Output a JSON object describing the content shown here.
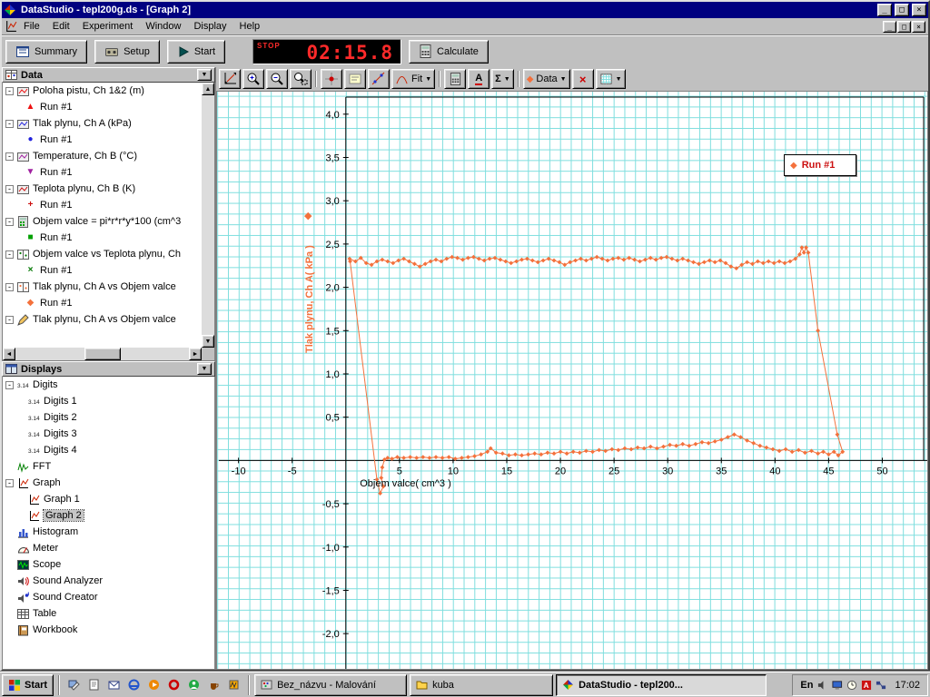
{
  "window": {
    "title": "DataStudio - tepl200g.ds - [Graph 2]"
  },
  "menu": {
    "items": [
      "File",
      "Edit",
      "Experiment",
      "Window",
      "Display",
      "Help"
    ]
  },
  "toolbar": {
    "summary_label": "Summary",
    "setup_label": "Setup",
    "start_label": "Start",
    "timer_stop": "STOP",
    "timer_value": "02:15.8",
    "calculate_label": "Calculate"
  },
  "graph_toolbar": {
    "fit_label": "Fit",
    "text_label": "A",
    "sigma_label": "Σ",
    "data_label": "Data"
  },
  "data_panel": {
    "title": "Data",
    "items": [
      {
        "label": "Poloha pistu, Ch 1&2 (m)",
        "icon": "measurement-icon",
        "marker": "triangle-up",
        "marker_color": "#ee1111",
        "run": "Run #1"
      },
      {
        "label": "Tlak plynu, Ch A (kPa)",
        "icon": "measurement-icon",
        "marker": "circle",
        "marker_color": "#2222dd",
        "run": "Run #1"
      },
      {
        "label": "Temperature, Ch B (°C)",
        "icon": "measurement-icon",
        "marker": "triangle-down",
        "marker_color": "#a020a0",
        "run": "Run #1"
      },
      {
        "label": "Teplota plynu, Ch B (K)",
        "icon": "measurement-icon",
        "marker": "plus",
        "marker_color": "#cc1111",
        "run": "Run #1"
      },
      {
        "label": "Objem valce = pi*r*r*y*100 (cm^3",
        "icon": "calculator-icon",
        "marker": "square",
        "marker_color": "#00a000",
        "run": "Run #1"
      },
      {
        "label": "Objem valce vs Teplota plynu, Ch",
        "icon": "xy-data-icon",
        "marker": "x",
        "marker_color": "#007700",
        "run": "Run #1"
      },
      {
        "label": "Tlak plynu, Ch A vs Objem valce",
        "icon": "xy-data-icon",
        "marker": "diamond",
        "marker_color": "#f4713c",
        "run": "Run #1"
      },
      {
        "label": "Tlak plynu, Ch A vs Objem valce",
        "icon": "pencil-icon",
        "marker": null,
        "marker_color": "#404040",
        "run": null
      }
    ]
  },
  "displays_panel": {
    "title": "Displays",
    "items": [
      {
        "label": "Digits",
        "icon": "digits-icon",
        "children": [
          {
            "label": "Digits 1",
            "icon": "digits-icon"
          },
          {
            "label": "Digits 2",
            "icon": "digits-icon"
          },
          {
            "label": "Digits 3",
            "icon": "digits-icon"
          },
          {
            "label": "Digits 4",
            "icon": "digits-icon"
          }
        ]
      },
      {
        "label": "FFT",
        "icon": "fft-icon"
      },
      {
        "label": "Graph",
        "icon": "graph-icon",
        "children": [
          {
            "label": "Graph 1",
            "icon": "graph-icon"
          },
          {
            "label": "Graph 2",
            "icon": "graph-icon",
            "selected": true
          }
        ]
      },
      {
        "label": "Histogram",
        "icon": "histogram-icon"
      },
      {
        "label": "Meter",
        "icon": "meter-icon"
      },
      {
        "label": "Scope",
        "icon": "scope-icon"
      },
      {
        "label": "Sound Analyzer",
        "icon": "sound-analyzer-icon"
      },
      {
        "label": "Sound Creator",
        "icon": "sound-creator-icon"
      },
      {
        "label": "Table",
        "icon": "table-icon"
      },
      {
        "label": "Workbook",
        "icon": "workbook-icon"
      }
    ]
  },
  "chart_data": {
    "type": "scatter",
    "title": "",
    "xlabel": "Objem valce( cm^3 )",
    "ylabel": "Tlak plynu, Ch A( kPa )",
    "xlim": [
      -12,
      54.7
    ],
    "ylim": [
      -2.47,
      4.26
    ],
    "grid": true,
    "grid_color": "#7edede",
    "legend_position": "top-right",
    "legend": {
      "label": "Run #1",
      "marker": "diamond",
      "marker_color": "#f4713c",
      "text_color": "#cc1111"
    },
    "xticks": [
      {
        "v": -10,
        "label": "-10"
      },
      {
        "v": -5,
        "label": "-5"
      },
      {
        "v": 5,
        "label": "5"
      },
      {
        "v": 10,
        "label": "10"
      },
      {
        "v": 15,
        "label": "15"
      },
      {
        "v": 20,
        "label": "20"
      },
      {
        "v": 25,
        "label": "25"
      },
      {
        "v": 30,
        "label": "30"
      },
      {
        "v": 35,
        "label": "35"
      },
      {
        "v": 40,
        "label": "40"
      },
      {
        "v": 45,
        "label": "45"
      },
      {
        "v": 50,
        "label": "50"
      }
    ],
    "yticks": [
      {
        "v": 4,
        "label": "4,0"
      },
      {
        "v": 3.5,
        "label": "3,5"
      },
      {
        "v": 3,
        "label": "3,0"
      },
      {
        "v": 2.5,
        "label": "2,5"
      },
      {
        "v": 2,
        "label": "2,0"
      },
      {
        "v": 1.5,
        "label": "1,5"
      },
      {
        "v": 1,
        "label": "1,0"
      },
      {
        "v": 0.5,
        "label": "0,5"
      },
      {
        "v": -0.5,
        "label": "-0,5"
      },
      {
        "v": -1,
        "label": "-1,0"
      },
      {
        "v": -1.5,
        "label": "-1,5"
      },
      {
        "v": -2,
        "label": "-2,0"
      }
    ],
    "series": [
      {
        "name": "Run #1",
        "color": "#f4713c",
        "marker": "diamond",
        "points": [
          [
            0.35,
            2.33
          ],
          [
            0.9,
            2.3
          ],
          [
            1.4,
            2.34
          ],
          [
            1.9,
            2.28
          ],
          [
            2.4,
            2.26
          ],
          [
            2.9,
            2.3
          ],
          [
            3.4,
            2.32
          ],
          [
            3.9,
            2.3
          ],
          [
            4.4,
            2.28
          ],
          [
            4.9,
            2.31
          ],
          [
            5.4,
            2.33
          ],
          [
            5.9,
            2.3
          ],
          [
            6.4,
            2.27
          ],
          [
            6.9,
            2.24
          ],
          [
            7.4,
            2.27
          ],
          [
            7.9,
            2.3
          ],
          [
            8.4,
            2.32
          ],
          [
            8.9,
            2.3
          ],
          [
            9.4,
            2.33
          ],
          [
            9.9,
            2.35
          ],
          [
            10.4,
            2.34
          ],
          [
            10.9,
            2.32
          ],
          [
            11.4,
            2.34
          ],
          [
            11.9,
            2.35
          ],
          [
            12.4,
            2.33
          ],
          [
            12.9,
            2.31
          ],
          [
            13.4,
            2.33
          ],
          [
            13.9,
            2.34
          ],
          [
            14.4,
            2.32
          ],
          [
            14.9,
            2.3
          ],
          [
            15.4,
            2.28
          ],
          [
            15.9,
            2.3
          ],
          [
            16.4,
            2.32
          ],
          [
            16.9,
            2.33
          ],
          [
            17.4,
            2.31
          ],
          [
            17.9,
            2.29
          ],
          [
            18.4,
            2.31
          ],
          [
            18.9,
            2.33
          ],
          [
            19.4,
            2.31
          ],
          [
            19.9,
            2.29
          ],
          [
            20.4,
            2.26
          ],
          [
            20.9,
            2.29
          ],
          [
            21.4,
            2.31
          ],
          [
            21.9,
            2.33
          ],
          [
            22.4,
            2.31
          ],
          [
            22.9,
            2.33
          ],
          [
            23.4,
            2.35
          ],
          [
            23.9,
            2.33
          ],
          [
            24.4,
            2.31
          ],
          [
            24.9,
            2.33
          ],
          [
            25.4,
            2.34
          ],
          [
            25.9,
            2.32
          ],
          [
            26.4,
            2.34
          ],
          [
            26.9,
            2.32
          ],
          [
            27.4,
            2.3
          ],
          [
            27.9,
            2.32
          ],
          [
            28.4,
            2.34
          ],
          [
            28.9,
            2.32
          ],
          [
            29.4,
            2.34
          ],
          [
            29.9,
            2.35
          ],
          [
            30.4,
            2.33
          ],
          [
            30.9,
            2.31
          ],
          [
            31.4,
            2.33
          ],
          [
            31.9,
            2.31
          ],
          [
            32.4,
            2.29
          ],
          [
            32.9,
            2.27
          ],
          [
            33.4,
            2.29
          ],
          [
            33.9,
            2.31
          ],
          [
            34.4,
            2.29
          ],
          [
            34.9,
            2.31
          ],
          [
            35.4,
            2.28
          ],
          [
            35.9,
            2.24
          ],
          [
            36.4,
            2.22
          ],
          [
            36.9,
            2.26
          ],
          [
            37.4,
            2.29
          ],
          [
            37.9,
            2.27
          ],
          [
            38.4,
            2.3
          ],
          [
            38.9,
            2.28
          ],
          [
            39.4,
            2.3
          ],
          [
            39.9,
            2.28
          ],
          [
            40.4,
            2.3
          ],
          [
            40.9,
            2.28
          ],
          [
            41.4,
            2.3
          ],
          [
            41.9,
            2.33
          ],
          [
            42.3,
            2.38
          ],
          [
            42.5,
            2.46
          ],
          [
            42.7,
            2.4
          ],
          [
            42.9,
            2.46
          ],
          [
            43.1,
            2.4
          ],
          [
            44,
            1.5
          ],
          [
            45.8,
            0.3
          ],
          [
            46.3,
            0.1
          ],
          [
            45.9,
            0.06
          ],
          [
            45.5,
            0.1
          ],
          [
            45,
            0.07
          ],
          [
            44.5,
            0.1
          ],
          [
            44,
            0.08
          ],
          [
            43.4,
            0.11
          ],
          [
            42.8,
            0.09
          ],
          [
            42.2,
            0.12
          ],
          [
            41.6,
            0.1
          ],
          [
            41,
            0.13
          ],
          [
            40.4,
            0.11
          ],
          [
            39.8,
            0.13
          ],
          [
            39.2,
            0.15
          ],
          [
            38.6,
            0.17
          ],
          [
            38,
            0.2
          ],
          [
            37.4,
            0.23
          ],
          [
            36.8,
            0.27
          ],
          [
            36.2,
            0.3
          ],
          [
            35.6,
            0.27
          ],
          [
            35,
            0.24
          ],
          [
            34.4,
            0.22
          ],
          [
            33.8,
            0.2
          ],
          [
            33.2,
            0.21
          ],
          [
            32.6,
            0.19
          ],
          [
            32,
            0.17
          ],
          [
            31.4,
            0.19
          ],
          [
            30.8,
            0.17
          ],
          [
            30.2,
            0.18
          ],
          [
            29.6,
            0.16
          ],
          [
            29,
            0.14
          ],
          [
            28.4,
            0.16
          ],
          [
            27.8,
            0.14
          ],
          [
            27.2,
            0.15
          ],
          [
            26.6,
            0.13
          ],
          [
            26,
            0.14
          ],
          [
            25.4,
            0.12
          ],
          [
            24.8,
            0.13
          ],
          [
            24.2,
            0.11
          ],
          [
            23.6,
            0.12
          ],
          [
            23,
            0.1
          ],
          [
            22.4,
            0.11
          ],
          [
            21.8,
            0.09
          ],
          [
            21.2,
            0.1
          ],
          [
            20.6,
            0.08
          ],
          [
            20,
            0.1
          ],
          [
            19.4,
            0.08
          ],
          [
            18.8,
            0.09
          ],
          [
            18.2,
            0.07
          ],
          [
            17.6,
            0.08
          ],
          [
            17,
            0.07
          ],
          [
            16.4,
            0.06
          ],
          [
            15.8,
            0.07
          ],
          [
            15.2,
            0.06
          ],
          [
            14.6,
            0.08
          ],
          [
            14,
            0.09
          ],
          [
            13.5,
            0.14
          ],
          [
            13.2,
            0.1
          ],
          [
            12.6,
            0.07
          ],
          [
            12,
            0.05
          ],
          [
            11.4,
            0.04
          ],
          [
            10.8,
            0.03
          ],
          [
            10.2,
            0.02
          ],
          [
            9.6,
            0.04
          ],
          [
            9,
            0.03
          ],
          [
            8.4,
            0.04
          ],
          [
            7.8,
            0.03
          ],
          [
            7.2,
            0.04
          ],
          [
            6.6,
            0.03
          ],
          [
            6,
            0.04
          ],
          [
            5.4,
            0.03
          ],
          [
            4.8,
            0.04
          ],
          [
            4.3,
            0.02
          ],
          [
            3.9,
            0.03
          ],
          [
            3.6,
            0.01
          ],
          [
            3.4,
            -0.08
          ],
          [
            3.3,
            -0.2
          ],
          [
            3.5,
            -0.3
          ],
          [
            3.2,
            -0.38
          ],
          [
            2.9,
            -0.22
          ],
          [
            0.4,
            2.3
          ]
        ]
      }
    ]
  },
  "taskbar": {
    "start_label": "Start",
    "quick_launch": [
      "show-desktop-icon",
      "notepad-icon",
      "outlook-express-icon",
      "internet-explorer-icon",
      "media-player-icon",
      "opera-icon",
      "messenger-icon",
      "java-icon",
      "winamp-icon"
    ],
    "tasks": [
      {
        "label": "Bez_názvu - Malování",
        "icon": "paint-icon",
        "active": false
      },
      {
        "label": "kuba",
        "icon": "folder-icon",
        "active": false
      },
      {
        "label": "DataStudio - tepl200...",
        "icon": "datastudio-icon",
        "active": true
      }
    ],
    "tray": {
      "lang": "En",
      "icons": [
        "volume-icon",
        "display-settings-icon",
        "scheduler-icon",
        "antivirus-icon",
        "network-icon"
      ],
      "clock": "17:02"
    }
  }
}
